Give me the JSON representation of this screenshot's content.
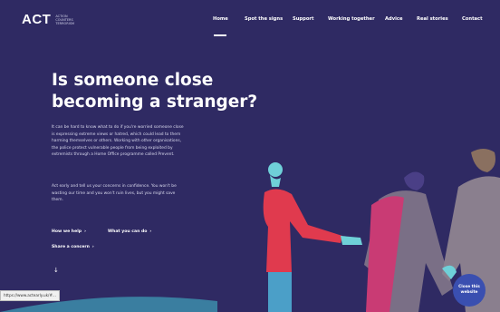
{
  "logo": {
    "text": "ACT",
    "subtitle_lines": [
      "ACTION",
      "COUNTERS",
      "TERRORISM"
    ]
  },
  "nav": {
    "items": [
      {
        "label": "Home"
      },
      {
        "label": "Spot the signs"
      },
      {
        "label": "Support"
      },
      {
        "label": "Working together"
      },
      {
        "label": "Advice"
      },
      {
        "label": "Real stories"
      },
      {
        "label": "Contact"
      }
    ]
  },
  "hero": {
    "title_lines": [
      "Is someone close",
      "becoming a stranger?"
    ],
    "paragraph1_lines": [
      "It can be hard to know what to do if you're worried someone close",
      "is expressing extreme views or hatred, which could lead to them",
      "harming themselves or others. Working with other organisations,",
      "the police protect vulnerable people from being exploited by",
      "extremists through a Home Office programme called Prevent."
    ],
    "paragraph2_lines": [
      "Act early and tell us your concerns in confidence. You won't be",
      "wasting our time and you won't ruin lives, but you might save",
      "them."
    ],
    "links": [
      {
        "label": "How we help"
      },
      {
        "label": "What you can do"
      },
      {
        "label": "Share a concern"
      }
    ],
    "down_arrow": "↓"
  },
  "status_url": "https://www.actearly.uk/#...",
  "close_button": {
    "lines": [
      "Close this",
      "website"
    ]
  },
  "colors": {
    "background": "#2f2a63",
    "accent_blue": "#3a4fb0",
    "figure_red": "#e03a4e",
    "figure_grey": "#6c6a7a"
  }
}
